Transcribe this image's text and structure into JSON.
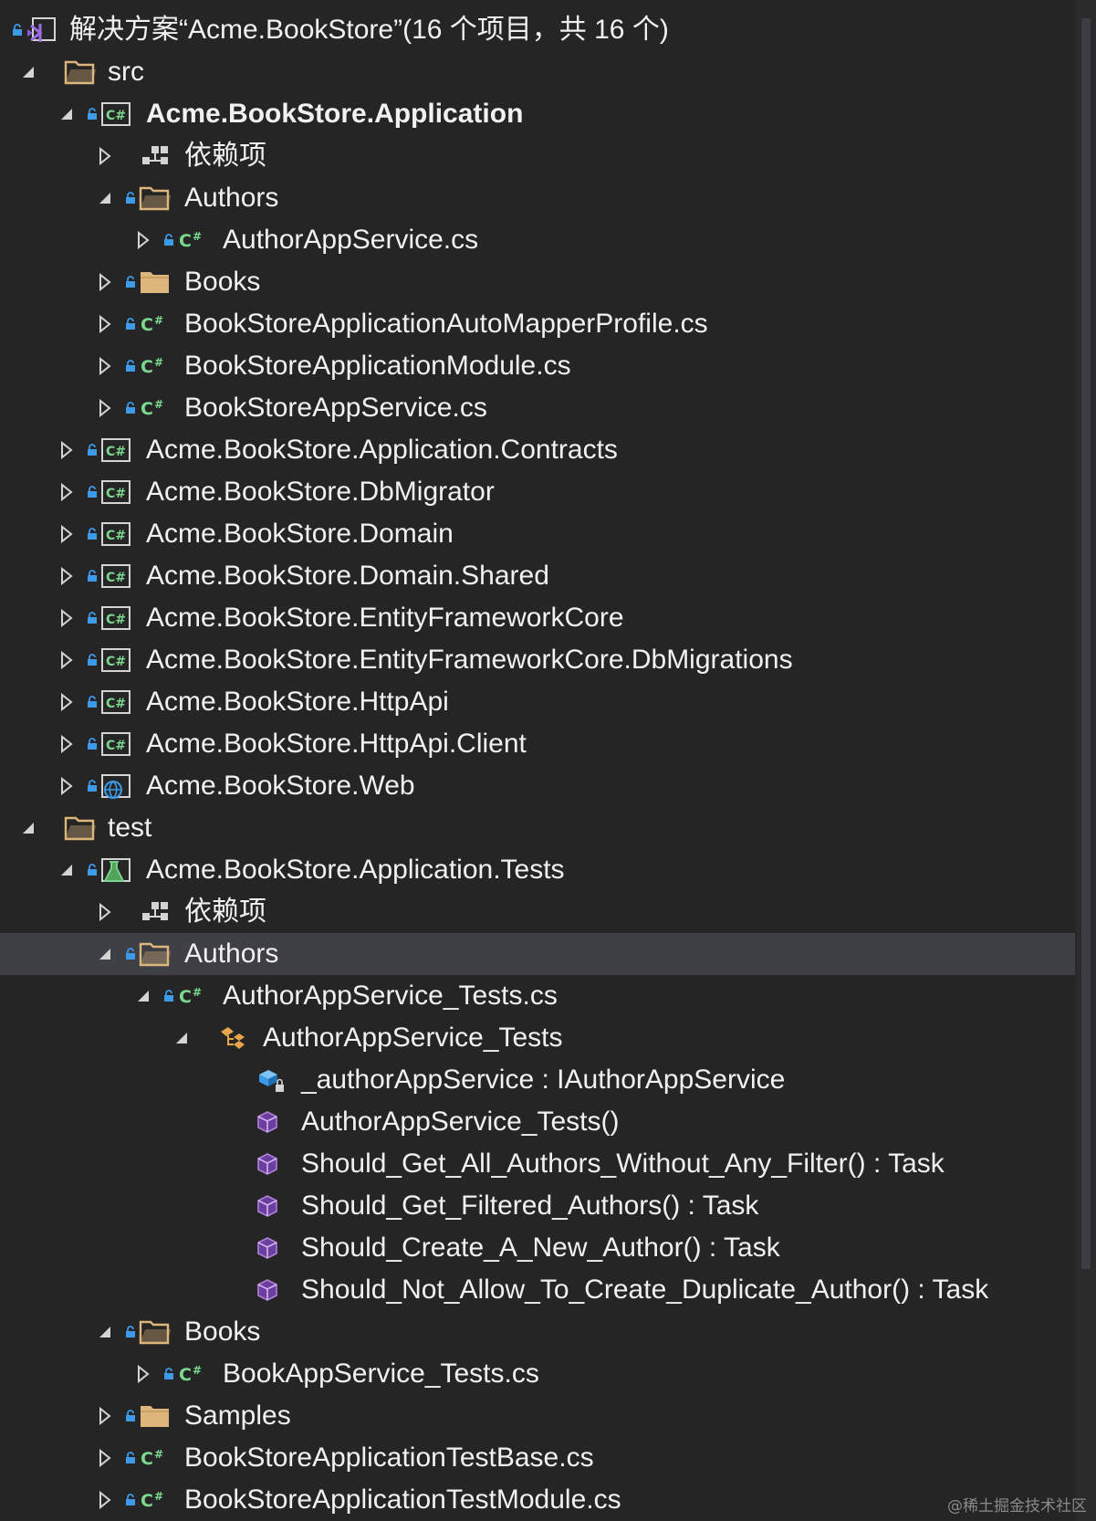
{
  "solution": {
    "title": "解决方案“Acme.BookStore”(16 个项目，共 16 个)"
  },
  "tree": [
    {
      "label": "src",
      "level": 0,
      "state": "expanded",
      "lock": false,
      "icon": "folder-open-icon",
      "kind": "folder"
    },
    {
      "label": "Acme.BookStore.Application",
      "level": 1,
      "state": "expanded",
      "lock": true,
      "icon": "csharp-project-icon",
      "kind": "project",
      "bold": true
    },
    {
      "label": "依赖项",
      "level": 2,
      "state": "collapsed",
      "lock": false,
      "icon": "dependencies-icon",
      "kind": "dependencies"
    },
    {
      "label": "Authors",
      "level": 2,
      "state": "expanded",
      "lock": true,
      "icon": "folder-open-icon",
      "kind": "folder"
    },
    {
      "label": "AuthorAppService.cs",
      "level": 3,
      "state": "collapsed",
      "lock": true,
      "icon": "csharp-file-icon",
      "kind": "file"
    },
    {
      "label": "Books",
      "level": 2,
      "state": "collapsed",
      "lock": true,
      "icon": "folder-icon",
      "kind": "folder"
    },
    {
      "label": "BookStoreApplicationAutoMapperProfile.cs",
      "level": 2,
      "state": "collapsed",
      "lock": true,
      "icon": "csharp-file-icon",
      "kind": "file"
    },
    {
      "label": "BookStoreApplicationModule.cs",
      "level": 2,
      "state": "collapsed",
      "lock": true,
      "icon": "csharp-file-icon",
      "kind": "file"
    },
    {
      "label": "BookStoreAppService.cs",
      "level": 2,
      "state": "collapsed",
      "lock": true,
      "icon": "csharp-file-icon",
      "kind": "file"
    },
    {
      "label": "Acme.BookStore.Application.Contracts",
      "level": 1,
      "state": "collapsed",
      "lock": true,
      "icon": "csharp-project-icon",
      "kind": "project"
    },
    {
      "label": "Acme.BookStore.DbMigrator",
      "level": 1,
      "state": "collapsed",
      "lock": true,
      "icon": "csharp-project-icon",
      "kind": "project"
    },
    {
      "label": "Acme.BookStore.Domain",
      "level": 1,
      "state": "collapsed",
      "lock": true,
      "icon": "csharp-project-icon",
      "kind": "project"
    },
    {
      "label": "Acme.BookStore.Domain.Shared",
      "level": 1,
      "state": "collapsed",
      "lock": true,
      "icon": "csharp-project-icon",
      "kind": "project"
    },
    {
      "label": "Acme.BookStore.EntityFrameworkCore",
      "level": 1,
      "state": "collapsed",
      "lock": true,
      "icon": "csharp-project-icon",
      "kind": "project"
    },
    {
      "label": "Acme.BookStore.EntityFrameworkCore.DbMigrations",
      "level": 1,
      "state": "collapsed",
      "lock": true,
      "icon": "csharp-project-icon",
      "kind": "project"
    },
    {
      "label": "Acme.BookStore.HttpApi",
      "level": 1,
      "state": "collapsed",
      "lock": true,
      "icon": "csharp-project-icon",
      "kind": "project"
    },
    {
      "label": "Acme.BookStore.HttpApi.Client",
      "level": 1,
      "state": "collapsed",
      "lock": true,
      "icon": "csharp-project-icon",
      "kind": "project"
    },
    {
      "label": "Acme.BookStore.Web",
      "level": 1,
      "state": "collapsed",
      "lock": true,
      "icon": "web-project-icon",
      "kind": "project"
    },
    {
      "label": "test",
      "level": 0,
      "state": "expanded",
      "lock": false,
      "icon": "folder-open-icon",
      "kind": "folder"
    },
    {
      "label": "Acme.BookStore.Application.Tests",
      "level": 1,
      "state": "expanded",
      "lock": true,
      "icon": "test-project-icon",
      "kind": "project"
    },
    {
      "label": "依赖项",
      "level": 2,
      "state": "collapsed",
      "lock": false,
      "icon": "dependencies-icon",
      "kind": "dependencies"
    },
    {
      "label": "Authors",
      "level": 2,
      "state": "expanded",
      "lock": true,
      "icon": "folder-open-icon",
      "kind": "folder",
      "selected": true
    },
    {
      "label": "AuthorAppService_Tests.cs",
      "level": 3,
      "state": "expanded",
      "lock": true,
      "icon": "csharp-file-icon",
      "kind": "file"
    },
    {
      "label": "AuthorAppService_Tests",
      "level": 4,
      "state": "expanded",
      "lock": false,
      "icon": "class-icon",
      "kind": "class"
    },
    {
      "label": "_authorAppService : IAuthorAppService",
      "level": 5,
      "state": "none",
      "lock": false,
      "icon": "private-field-icon",
      "kind": "member"
    },
    {
      "label": "AuthorAppService_Tests()",
      "level": 5,
      "state": "none",
      "lock": false,
      "icon": "method-icon",
      "kind": "member"
    },
    {
      "label": "Should_Get_All_Authors_Without_Any_Filter() : Task",
      "level": 5,
      "state": "none",
      "lock": false,
      "icon": "method-icon",
      "kind": "member"
    },
    {
      "label": "Should_Get_Filtered_Authors() : Task",
      "level": 5,
      "state": "none",
      "lock": false,
      "icon": "method-icon",
      "kind": "member"
    },
    {
      "label": "Should_Create_A_New_Author() : Task",
      "level": 5,
      "state": "none",
      "lock": false,
      "icon": "method-icon",
      "kind": "member"
    },
    {
      "label": "Should_Not_Allow_To_Create_Duplicate_Author() : Task",
      "level": 5,
      "state": "none",
      "lock": false,
      "icon": "method-icon",
      "kind": "member"
    },
    {
      "label": "Books",
      "level": 2,
      "state": "expanded",
      "lock": true,
      "icon": "folder-open-icon",
      "kind": "folder"
    },
    {
      "label": "BookAppService_Tests.cs",
      "level": 3,
      "state": "collapsed",
      "lock": true,
      "icon": "csharp-file-icon",
      "kind": "file"
    },
    {
      "label": "Samples",
      "level": 2,
      "state": "collapsed",
      "lock": true,
      "icon": "folder-icon",
      "kind": "folder"
    },
    {
      "label": "BookStoreApplicationTestBase.cs",
      "level": 2,
      "state": "collapsed",
      "lock": true,
      "icon": "csharp-file-icon",
      "kind": "file"
    },
    {
      "label": "BookStoreApplicationTestModule.cs",
      "level": 2,
      "state": "collapsed",
      "lock": true,
      "icon": "csharp-file-icon",
      "kind": "file"
    }
  ],
  "watermark": "@稀土掘金技术社区",
  "colors": {
    "background": "#252526",
    "selection": "#3f3f46",
    "text": "#f1f1f1",
    "lock": "#3c9ae8",
    "csharp": "#7bd88f",
    "folder": "#dcb67a",
    "method": "#b180d7"
  }
}
